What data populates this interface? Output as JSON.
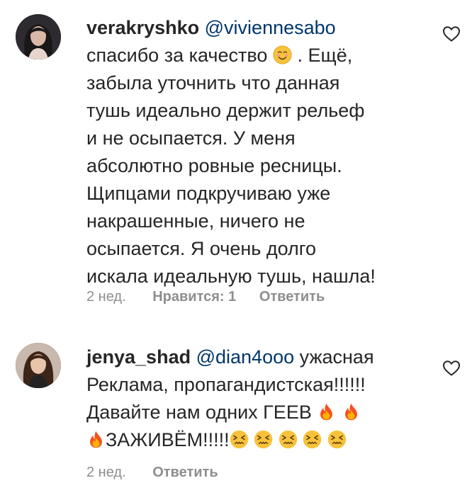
{
  "comments": [
    {
      "username": "verakryshko",
      "mention": "@viviennesabo",
      "lines": [
        "спасибо за качество",
        ". Ещё,",
        "забыла уточнить что данная",
        "тушь идеально держит рельеф",
        "и не осыпается. У меня",
        "абсолютно ровные ресницы.",
        "Щипцами подкручиваю уже",
        "накрашенные, ничего не",
        "осыпается. Я очень долго",
        "искала идеальную тушь, нашла!"
      ],
      "emoji": [
        "smiling-face"
      ],
      "time": "2 нед.",
      "likes": "Нравится: 1",
      "reply": "Ответить"
    },
    {
      "username": "jenya_shad",
      "mention": "@dian4ooo",
      "lines": [
        "ужасная",
        "Реклама, пропагандистская!!!!!!",
        "Давайте нам одних ГЕЕВ",
        "ЗАЖИВЁМ!!!!!"
      ],
      "emoji": [
        "fire",
        "fire",
        "fire",
        "confounded-face",
        "confounded-face",
        "confounded-face",
        "confounded-face",
        "confounded-face"
      ],
      "time": "2 нед.",
      "reply": "Ответить"
    }
  ],
  "colors": {
    "text": "#262626",
    "mention": "#00376b",
    "meta": "#8e8e8e"
  },
  "icons": {
    "like": "heart-outline-icon"
  }
}
